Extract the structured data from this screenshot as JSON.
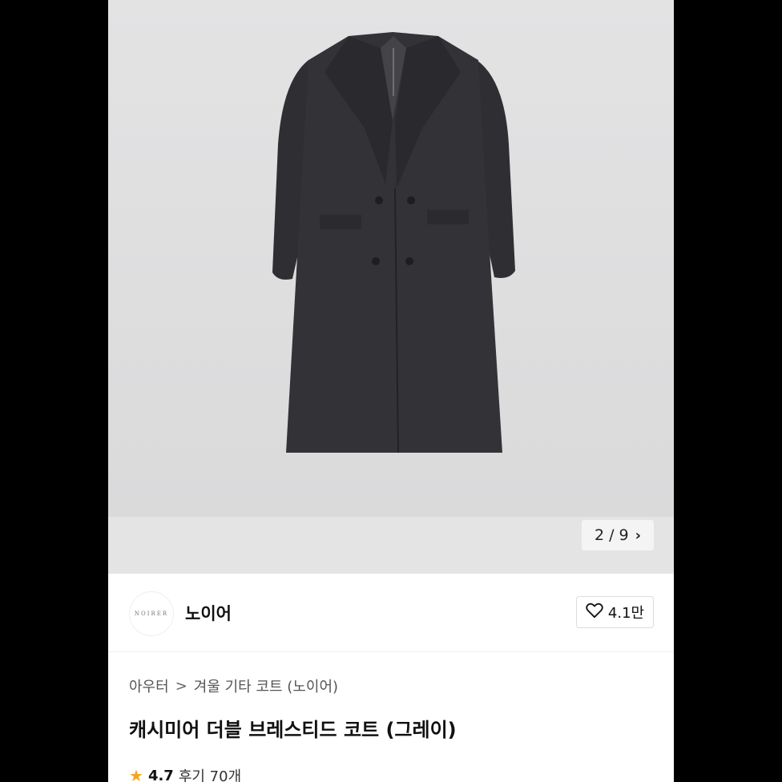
{
  "gallery": {
    "image_alt": "gray cashmere double breasted coat",
    "counter": "2 / 9",
    "next_icon": "chevron-right-icon"
  },
  "brand": {
    "logo_text": "NOIRER",
    "name": "노이어",
    "like_count": "4.1만",
    "like_icon": "heart-outline-icon"
  },
  "breadcrumb": {
    "items": [
      "아우터",
      "겨울 기타 코트 (노이어)"
    ],
    "separator": ">"
  },
  "product": {
    "title": "캐시미어 더블 브레스티드 코트 (그레이)",
    "rating": "4.7",
    "reviews": "후기 70개",
    "star_color": "#f4a51c"
  }
}
